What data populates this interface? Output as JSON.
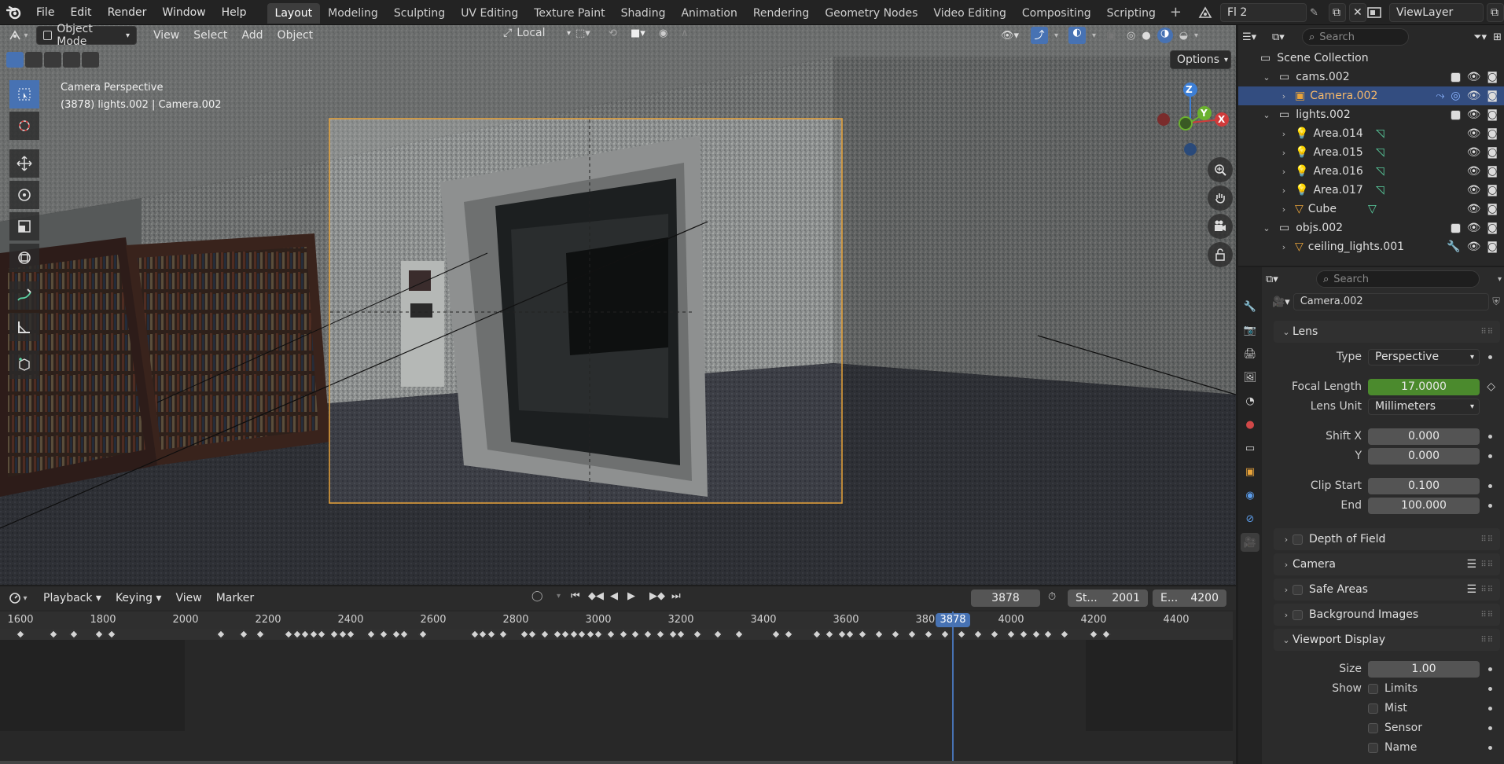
{
  "topbar": {
    "menus": [
      "File",
      "Edit",
      "Render",
      "Window",
      "Help"
    ],
    "workspaces": [
      "Layout",
      "Modeling",
      "Sculpting",
      "UV Editing",
      "Texture Paint",
      "Shading",
      "Animation",
      "Rendering",
      "Geometry Nodes",
      "Video Editing",
      "Compositing",
      "Scripting"
    ],
    "active_workspace": "Layout",
    "scene_name": "Fl 2",
    "view_layer": "ViewLayer"
  },
  "viewport": {
    "mode": "Object Mode",
    "menus": [
      "View",
      "Select",
      "Add",
      "Object"
    ],
    "orientation": "Local",
    "options_label": "Options",
    "overlay_title": "Camera Perspective",
    "overlay_subtitle": "(3878) lights.002 | Camera.002",
    "axes": [
      "Z",
      "Y",
      "X"
    ]
  },
  "timeline": {
    "menus": [
      "Playback",
      "Keying",
      "View",
      "Marker"
    ],
    "current_frame": "3878",
    "start_label": "St...",
    "start": "2001",
    "end_label": "E...",
    "end": "4200",
    "ruler": [
      "1600",
      "1800",
      "2000",
      "2200",
      "2400",
      "2600",
      "2800",
      "3000",
      "3200",
      "3400",
      "3600",
      "3800",
      "4000",
      "4200",
      "4400"
    ],
    "playhead_label": "3878"
  },
  "outliner": {
    "search_placeholder": "Search",
    "rows": [
      {
        "label": "Scene Collection",
        "indent": 0,
        "kind": "scene"
      },
      {
        "label": "cams.002",
        "indent": 1,
        "kind": "collection"
      },
      {
        "label": "Camera.002",
        "indent": 2,
        "kind": "camera",
        "selected": true
      },
      {
        "label": "lights.002",
        "indent": 1,
        "kind": "collection"
      },
      {
        "label": "Area.014",
        "indent": 2,
        "kind": "light"
      },
      {
        "label": "Area.015",
        "indent": 2,
        "kind": "light"
      },
      {
        "label": "Area.016",
        "indent": 2,
        "kind": "light"
      },
      {
        "label": "Area.017",
        "indent": 2,
        "kind": "light"
      },
      {
        "label": "Cube",
        "indent": 2,
        "kind": "mesh"
      },
      {
        "label": "objs.002",
        "indent": 1,
        "kind": "collection"
      },
      {
        "label": "ceiling_lights.001",
        "indent": 2,
        "kind": "mesh"
      }
    ]
  },
  "properties": {
    "search_placeholder": "Search",
    "object_name": "Camera.002",
    "lens_panel": "Lens",
    "type_label": "Type",
    "type_value": "Perspective",
    "focal_label": "Focal Length",
    "focal_value": "17.0000",
    "lens_unit_label": "Lens Unit",
    "lens_unit_value": "Millimeters",
    "shiftx_label": "Shift X",
    "shiftx_value": "0.000",
    "shifty_label": "Y",
    "shifty_value": "0.000",
    "clipstart_label": "Clip Start",
    "clipstart_value": "0.100",
    "clipend_label": "End",
    "clipend_value": "100.000",
    "panels": [
      "Depth of Field",
      "Camera",
      "Safe Areas",
      "Background Images",
      "Viewport Display"
    ],
    "size_label": "Size",
    "size_value": "1.00",
    "show_label": "Show",
    "show_items": [
      "Limits",
      "Mist",
      "Sensor",
      "Name"
    ]
  },
  "colors": {
    "accent": "#4772b3",
    "selection": "#334d80",
    "camera_frame": "#e8a33a",
    "focal_green": "#4b8a2d"
  }
}
